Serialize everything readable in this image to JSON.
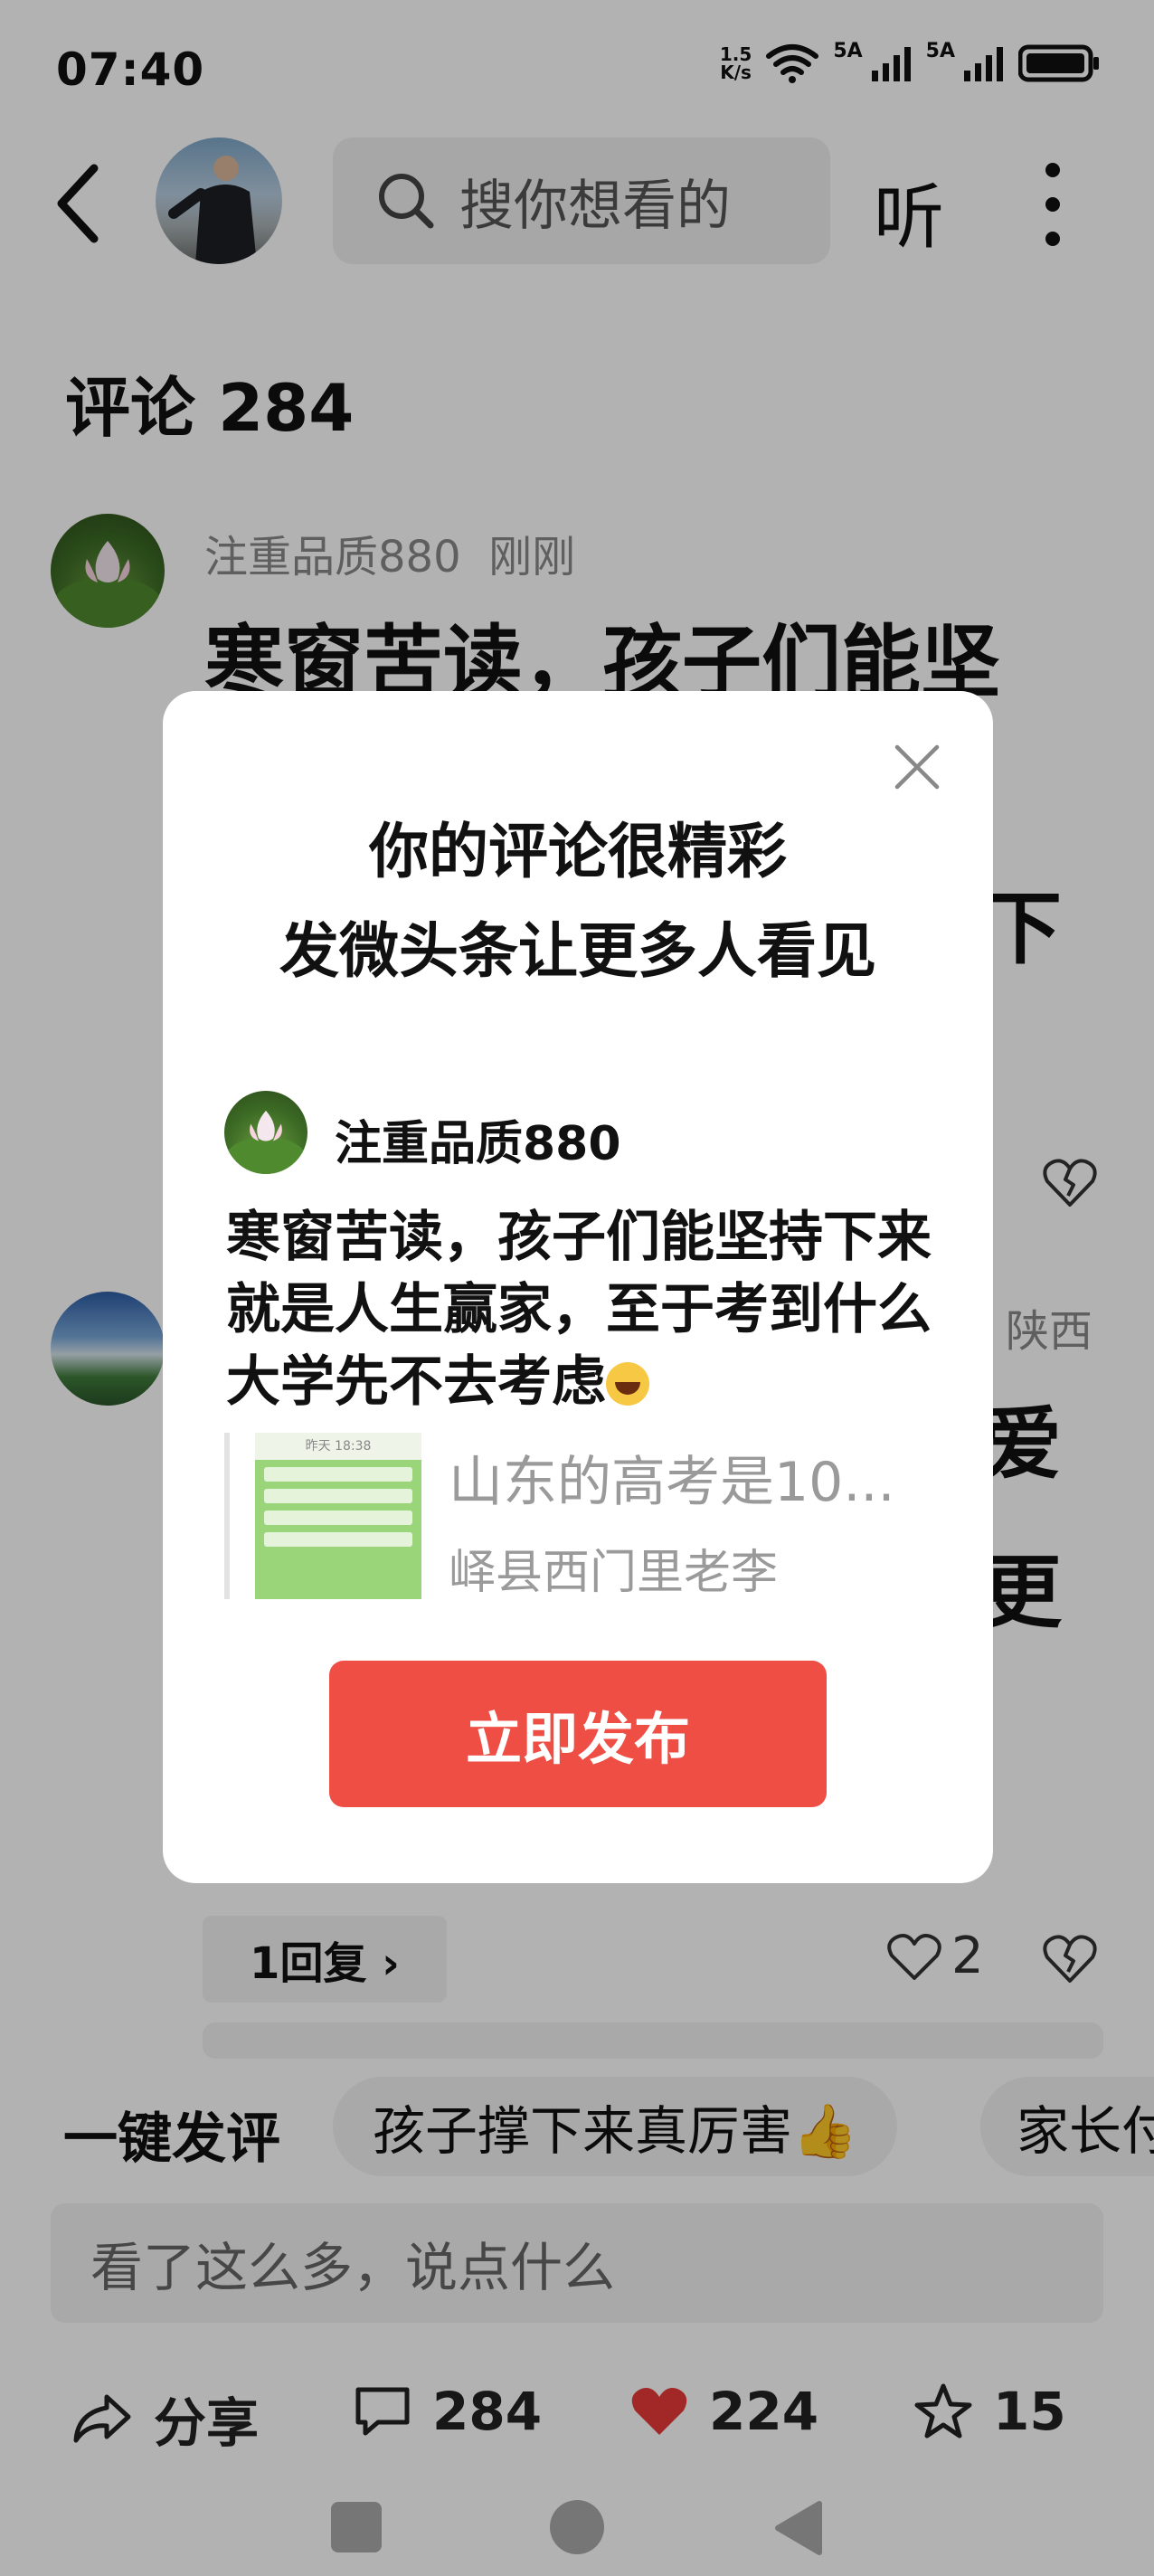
{
  "status_bar": {
    "time": "07:40",
    "net_speed_value": "1.5",
    "net_speed_unit": "K/s",
    "sim1_label": "5A",
    "sim2_label": "5A"
  },
  "header": {
    "search_placeholder": "搜你想看的",
    "listen_label": "听"
  },
  "comments": {
    "title": "评论 284",
    "items": [
      {
        "username": "注重品质880",
        "time": "刚刚",
        "text_visible": "寒窗苦读，孩子们能坚",
        "text_tail": "下"
      },
      {
        "location": "陕西",
        "text_frag1": "爱",
        "text_frag2": "更",
        "reply_label": "1回复 ›",
        "like_count": "2"
      }
    ]
  },
  "quick_comment": {
    "label": "一键发评",
    "chips": [
      "孩子撑下来真厉害👍",
      "家长付"
    ]
  },
  "input": {
    "placeholder": "看了这么多，说点什么"
  },
  "actions": {
    "share_label": "分享",
    "comment_count": "284",
    "like_count": "224",
    "favorite_count": "15"
  },
  "modal": {
    "title_line1": "你的评论很精彩",
    "title_line2": "发微头条让更多人看见",
    "username": "注重品质880",
    "comment_text": "寒窗苦读，孩子们能坚持下来就是人生赢家，至于考到什么大学先不去考虑",
    "quote_title": "山东的高考是10...",
    "quote_author": "峄县西门里老李",
    "quote_thumb_header": "昨天 18:38",
    "publish_label": "立即发布"
  },
  "colors": {
    "accent_red": "#ee4e44",
    "heart_red": "#e83a3a",
    "overlay": "rgba(0,0,0,0.30)"
  }
}
